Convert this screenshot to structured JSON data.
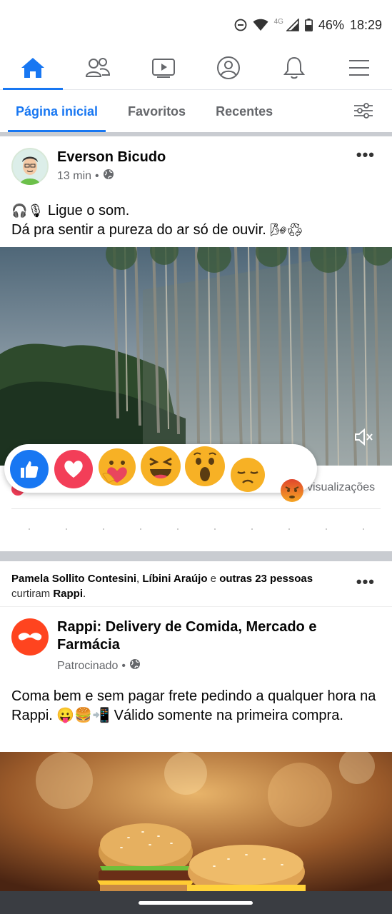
{
  "status_bar": {
    "network": "4G",
    "battery": "46%",
    "time": "18:29",
    "icons": [
      "dnd-icon",
      "wifi-icon",
      "signal-icon",
      "battery-icon"
    ]
  },
  "top_nav": {
    "items": [
      {
        "icon": "home-icon",
        "active": true
      },
      {
        "icon": "friends-icon",
        "active": false
      },
      {
        "icon": "video-icon",
        "active": false
      },
      {
        "icon": "profile-icon",
        "active": false
      },
      {
        "icon": "bell-icon",
        "active": false
      },
      {
        "icon": "menu-icon",
        "active": false
      }
    ]
  },
  "sub_tabs": {
    "items": [
      {
        "label": "Página inicial",
        "active": true
      },
      {
        "label": "Favoritos",
        "active": false
      },
      {
        "label": "Recentes",
        "active": false
      }
    ],
    "filter_icon": "sliders-icon"
  },
  "post1": {
    "author": "Everson Bicudo",
    "time": "13 min",
    "separator": "•",
    "audience_icon": "globe-icon",
    "line1": "Ligue o som.",
    "line2": "Dá pra sentir a pureza do ar só de ouvir.",
    "line1_emojis": "🎧🎙",
    "line2_emojis": "🌬♻",
    "views_label": "visualizações",
    "reactions": [
      "like",
      "love",
      "care",
      "haha",
      "wow",
      "sad",
      "angry"
    ]
  },
  "post2": {
    "liked_by": {
      "name1": "Pamela Sollito Contesini",
      "comma": ",",
      "name2": "Líbini Araújo",
      "joiner": "e",
      "others": "outras 23 pessoas",
      "verb": "curtiram",
      "page": "Rappi",
      "end": "."
    },
    "author": "Rappi: Delivery de Comida, Mercado e Farmácia",
    "sponsored": "Patrocinado",
    "separator": "•",
    "audience_icon": "globe-icon",
    "text": "Coma bem e sem pagar frete pedindo a qualquer hora na Rappi. 😛🍔📲 Válido somente na primeira compra."
  },
  "colors": {
    "accent": "#1877f2",
    "muted": "#65676b",
    "rappi": "#ff441f"
  }
}
